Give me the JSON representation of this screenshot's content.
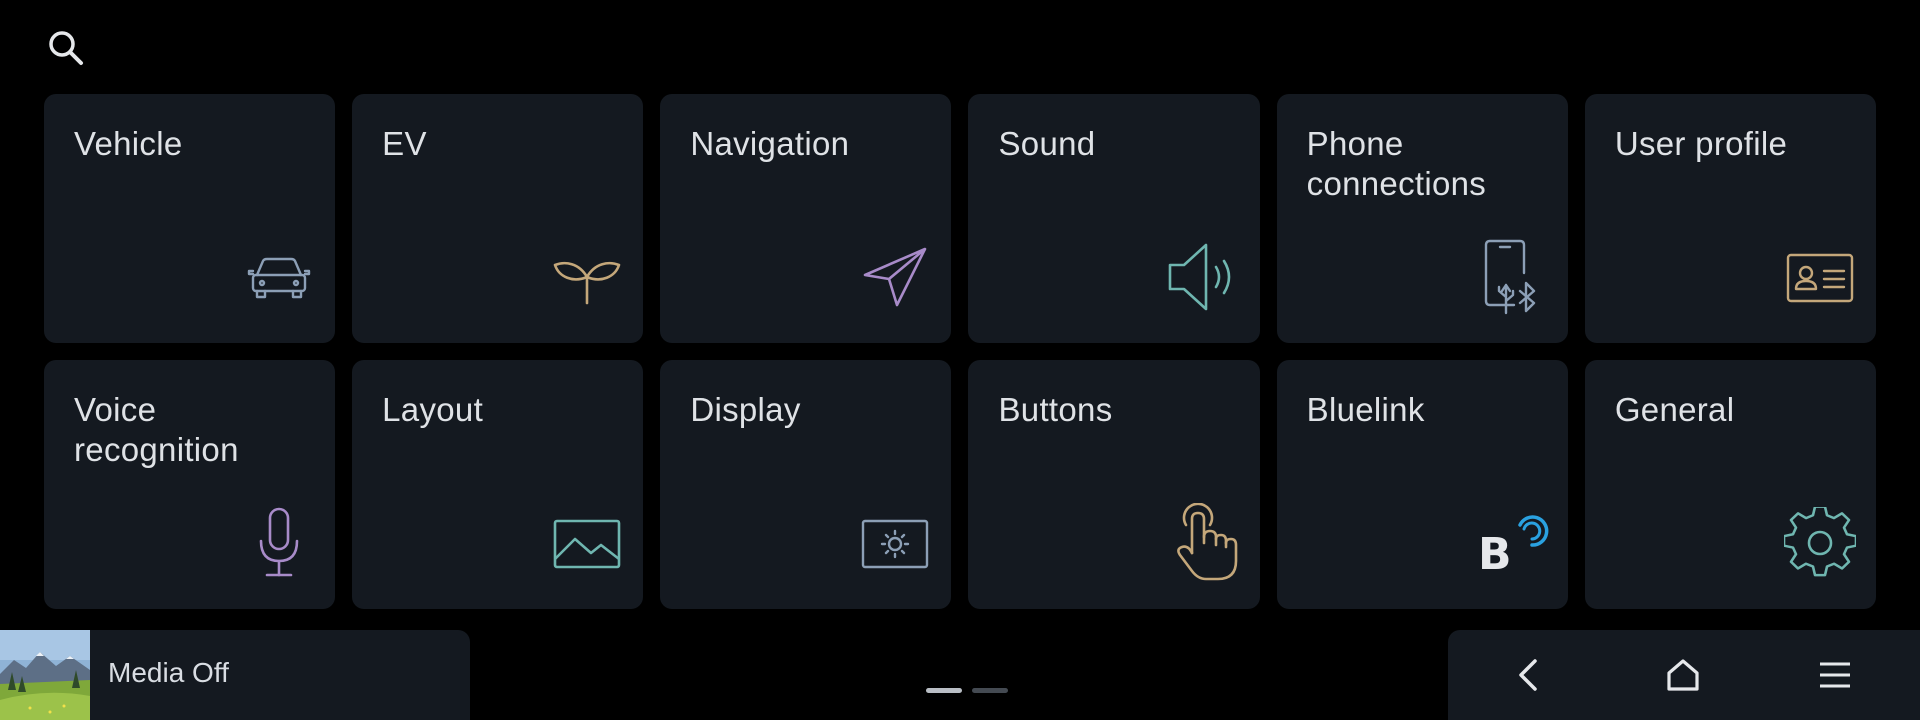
{
  "search": {
    "icon": "search-icon"
  },
  "tiles": [
    {
      "label": "Vehicle",
      "icon": "car-icon",
      "color": "#8c9fb6"
    },
    {
      "label": "EV",
      "icon": "sprout-icon",
      "color": "#c4a77a"
    },
    {
      "label": "Navigation",
      "icon": "navigation-arrow-icon",
      "color": "#a88bc9"
    },
    {
      "label": "Sound",
      "icon": "speaker-icon",
      "color": "#6fb6b0"
    },
    {
      "label": "Phone connections",
      "icon": "phone-connection-icon",
      "color": "#8c9fb6"
    },
    {
      "label": "User profile",
      "icon": "profile-card-icon",
      "color": "#c4a77a"
    },
    {
      "label": "Voice recognition",
      "icon": "microphone-icon",
      "color": "#a88bc9"
    },
    {
      "label": "Layout",
      "icon": "image-icon",
      "color": "#6fb6b0"
    },
    {
      "label": "Display",
      "icon": "display-brightness-icon",
      "color": "#8c9fb6"
    },
    {
      "label": "Buttons",
      "icon": "touch-hand-icon",
      "color": "#c4a77a"
    },
    {
      "label": "Bluelink",
      "icon": "bluelink-icon",
      "color": "#2aa1e0"
    },
    {
      "label": "General",
      "icon": "gear-icon",
      "color": "#6fb6b0"
    }
  ],
  "media": {
    "label": "Media Off",
    "thumb_icon": "album-art-thumbnail"
  },
  "pager": {
    "pages": 2,
    "current": 1
  },
  "nav": {
    "back_icon": "back-chevron-icon",
    "home_icon": "home-icon",
    "menu_icon": "menu-icon"
  }
}
